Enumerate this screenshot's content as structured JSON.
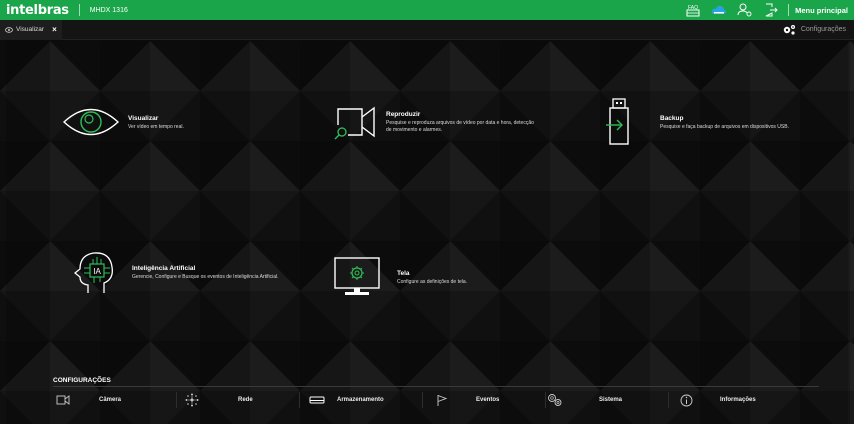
{
  "header": {
    "logo": "intelbras",
    "model": "MHDX 1316",
    "faq_label": "FAQ",
    "main_menu": "Menu principal"
  },
  "tabbar": {
    "tab_label": "Visualizar",
    "tab_close": "×",
    "config_label": "Configurações"
  },
  "tiles": {
    "visualizar": {
      "title": "Visualizar",
      "desc": "Ver vídeo em tempo real."
    },
    "reproduzir": {
      "title": "Reproduzir",
      "desc1": "Pesquise e reproduza arquivos de vídeo por data e hora, detecção",
      "desc2": "de movimento e alarmes."
    },
    "backup": {
      "title": "Backup",
      "desc": "Pesquise e faça backup de arquivos em dispositivos USB."
    },
    "ia": {
      "title": "Inteligência Artificial",
      "desc": "Gerencie, Configure e Busque os eventos de Inteligência Artificial.",
      "icon_text": "IA"
    },
    "tela": {
      "title": "Tela",
      "desc": "Configure as definições de tela."
    }
  },
  "config_section": {
    "title": "CONFIGURAÇÕES",
    "items": [
      {
        "label": "Câmera",
        "icon": "camera-icon"
      },
      {
        "label": "Rede",
        "icon": "network-icon"
      },
      {
        "label": "Armazenamento",
        "icon": "storage-icon"
      },
      {
        "label": "Eventos",
        "icon": "flag-icon"
      },
      {
        "label": "Sistema",
        "icon": "gears-icon"
      },
      {
        "label": "Informações",
        "icon": "info-icon"
      }
    ]
  },
  "colors": {
    "brand_green": "#1aa54a",
    "background": "#101010",
    "text": "#ffffff"
  }
}
